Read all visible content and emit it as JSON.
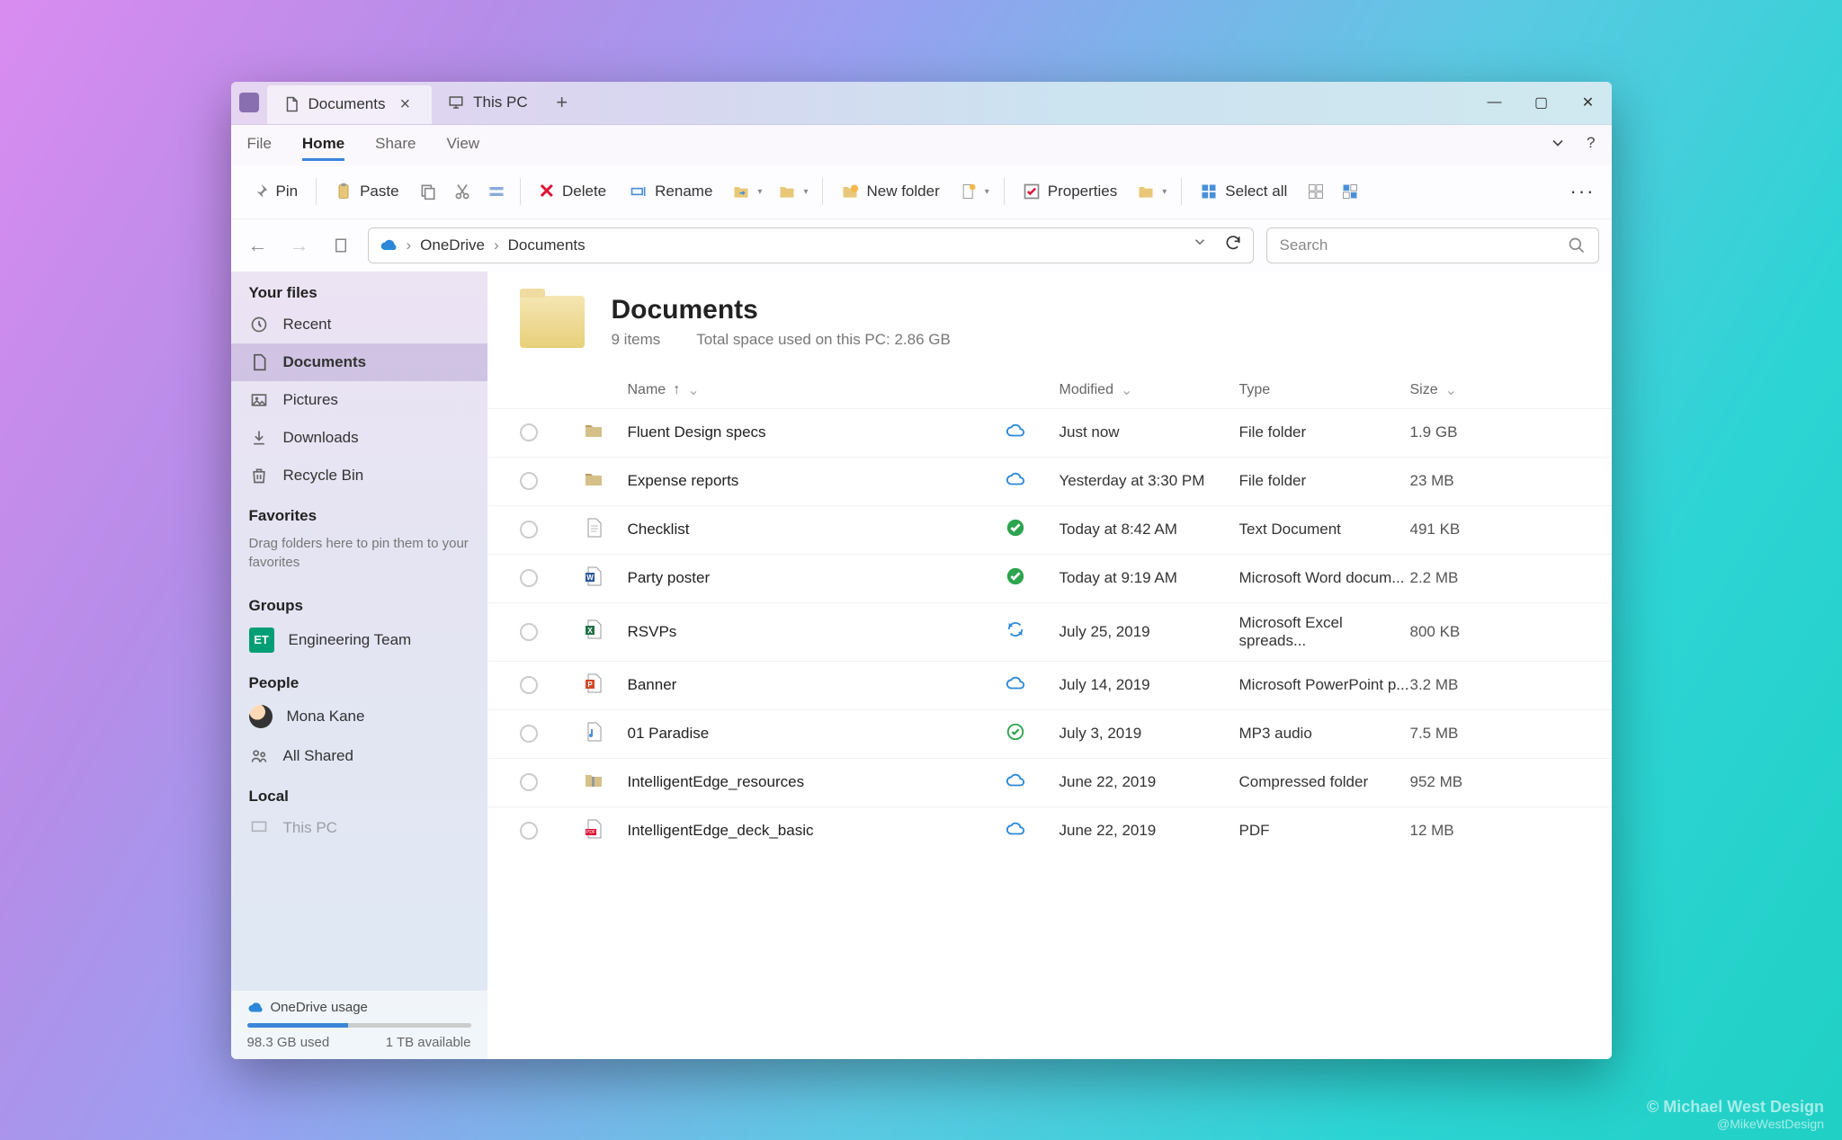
{
  "titlebar": {
    "tabs": [
      {
        "label": "Documents",
        "active": true
      },
      {
        "label": "This PC",
        "active": false
      }
    ]
  },
  "menu": {
    "items": [
      "File",
      "Home",
      "Share",
      "View"
    ],
    "active": "Home"
  },
  "toolbar": {
    "pin": "Pin",
    "paste": "Paste",
    "delete": "Delete",
    "rename": "Rename",
    "new_folder": "New folder",
    "properties": "Properties",
    "select_all": "Select all"
  },
  "breadcrumb": {
    "items": [
      "OneDrive",
      "Documents"
    ]
  },
  "search": {
    "placeholder": "Search"
  },
  "sidebar": {
    "your_files_label": "Your files",
    "items": [
      {
        "icon": "recent-icon",
        "label": "Recent"
      },
      {
        "icon": "document-icon",
        "label": "Documents",
        "active": true
      },
      {
        "icon": "pictures-icon",
        "label": "Pictures"
      },
      {
        "icon": "downloads-icon",
        "label": "Downloads"
      },
      {
        "icon": "recycle-icon",
        "label": "Recycle Bin"
      }
    ],
    "favorites_label": "Favorites",
    "favorites_hint": "Drag folders here to pin them to your favorites",
    "groups_label": "Groups",
    "groups": [
      {
        "badge": "ET",
        "label": "Engineering Team"
      }
    ],
    "people_label": "People",
    "people": [
      {
        "icon": "avatar",
        "label": "Mona Kane"
      },
      {
        "icon": "shared-icon",
        "label": "All Shared"
      }
    ],
    "local_label": "Local",
    "local": [
      {
        "label": "This PC"
      }
    ],
    "usage": {
      "title": "OneDrive usage",
      "used": "98.3 GB used",
      "available": "1 TB available"
    }
  },
  "header": {
    "title": "Documents",
    "items": "9 items",
    "space": "Total space used on this PC: 2.86 GB"
  },
  "columns": {
    "name": "Name",
    "modified": "Modified",
    "type": "Type",
    "size": "Size"
  },
  "rows": [
    {
      "icon": "folder",
      "name": "Fluent Design specs",
      "status": "cloud",
      "modified": "Just now",
      "type": "File folder",
      "size": "1.9 GB"
    },
    {
      "icon": "folder",
      "name": "Expense reports",
      "status": "cloud",
      "modified": "Yesterday at 3:30 PM",
      "type": "File folder",
      "size": "23 MB"
    },
    {
      "icon": "txt",
      "name": "Checklist",
      "status": "synced",
      "modified": "Today at 8:42 AM",
      "type": "Text Document",
      "size": "491 KB"
    },
    {
      "icon": "word",
      "name": "Party poster",
      "status": "synced",
      "modified": "Today at 9:19 AM",
      "type": "Microsoft Word docum...",
      "size": "2.2 MB"
    },
    {
      "icon": "excel",
      "name": "RSVPs",
      "status": "syncing",
      "modified": "July 25, 2019",
      "type": "Microsoft Excel spreads...",
      "size": "800 KB"
    },
    {
      "icon": "ppt",
      "name": "Banner",
      "status": "cloud",
      "modified": "July 14, 2019",
      "type": "Microsoft PowerPoint p...",
      "size": "3.2 MB"
    },
    {
      "icon": "audio",
      "name": "01 Paradise",
      "status": "available",
      "modified": "July 3, 2019",
      "type": "MP3 audio",
      "size": "7.5 MB"
    },
    {
      "icon": "zip",
      "name": "IntelligentEdge_resources",
      "status": "cloud",
      "modified": "June 22, 2019",
      "type": "Compressed folder",
      "size": "952 MB"
    },
    {
      "icon": "pdf",
      "name": "IntelligentEdge_deck_basic",
      "status": "cloud",
      "modified": "June 22, 2019",
      "type": "PDF",
      "size": "12 MB"
    }
  ],
  "watermark": {
    "line1": "© Michael West Design",
    "line2": "@MikeWestDesign"
  }
}
